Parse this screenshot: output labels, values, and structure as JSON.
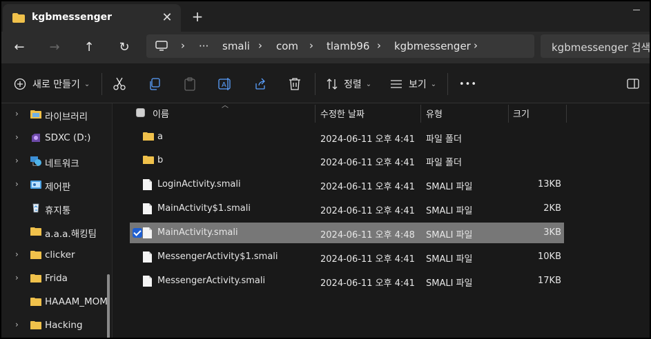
{
  "window": {
    "tab_title": "kgbmessenger",
    "tab_close": "✕",
    "new_tab": "+"
  },
  "nav": {
    "back": "←",
    "forward": "→",
    "up": "↑",
    "refresh": "↻"
  },
  "address": {
    "more": "···",
    "parts": [
      "smali",
      "com",
      "tlamb96",
      "kgbmessenger"
    ],
    "chevron": "›"
  },
  "search": {
    "placeholder": "kgbmessenger 검색"
  },
  "toolbar": {
    "new_label": "새로 만들기",
    "sort_label": "정렬",
    "view_label": "보기",
    "more_label": "•••"
  },
  "sidebar": {
    "items": [
      {
        "label": "라이브러리",
        "icon": "library-icon",
        "chevron": "›"
      },
      {
        "label": "SDXC (D:)",
        "icon": "sd-card-icon",
        "chevron": "›"
      },
      {
        "label": "네트워크",
        "icon": "network-icon",
        "chevron": "›"
      },
      {
        "label": "제어판",
        "icon": "control-panel-icon",
        "chevron": "›"
      },
      {
        "label": "휴지통",
        "icon": "recycle-bin-icon",
        "chevron": ""
      },
      {
        "label": "a.a.a.해킹팀",
        "icon": "folder-icon",
        "chevron": ""
      },
      {
        "label": "clicker",
        "icon": "folder-icon",
        "chevron": "›"
      },
      {
        "label": "Frida",
        "icon": "folder-icon",
        "chevron": "›"
      },
      {
        "label": "HAAAM_MOM",
        "icon": "folder-icon",
        "chevron": ""
      },
      {
        "label": "Hacking",
        "icon": "folder-icon",
        "chevron": "›"
      }
    ]
  },
  "columns": {
    "name": "이름",
    "modified": "수정한 날짜",
    "type": "유형",
    "size": "크기"
  },
  "files": [
    {
      "name": "a",
      "date": "2024-06-11 오후 4:41",
      "type": "파일 폴더",
      "size": "",
      "kind": "folder",
      "selected": false
    },
    {
      "name": "b",
      "date": "2024-06-11 오후 4:41",
      "type": "파일 폴더",
      "size": "",
      "kind": "folder",
      "selected": false
    },
    {
      "name": "LoginActivity.smali",
      "date": "2024-06-11 오후 4:41",
      "type": "SMALI 파일",
      "size": "13KB",
      "kind": "file",
      "selected": false
    },
    {
      "name": "MainActivity$1.smali",
      "date": "2024-06-11 오후 4:41",
      "type": "SMALI 파일",
      "size": "2KB",
      "kind": "file",
      "selected": false
    },
    {
      "name": "MainActivity.smali",
      "date": "2024-06-11 오후 4:48",
      "type": "SMALI 파일",
      "size": "3KB",
      "kind": "file",
      "selected": true
    },
    {
      "name": "MessengerActivity$1.smali",
      "date": "2024-06-11 오후 4:41",
      "type": "SMALI 파일",
      "size": "10KB",
      "kind": "file",
      "selected": false
    },
    {
      "name": "MessengerActivity.smali",
      "date": "2024-06-11 오후 4:41",
      "type": "SMALI 파일",
      "size": "17KB",
      "kind": "file",
      "selected": false
    }
  ],
  "colors": {
    "folder": "#f0c14b",
    "selection": "#777777",
    "accent": "#1f5fd1"
  }
}
